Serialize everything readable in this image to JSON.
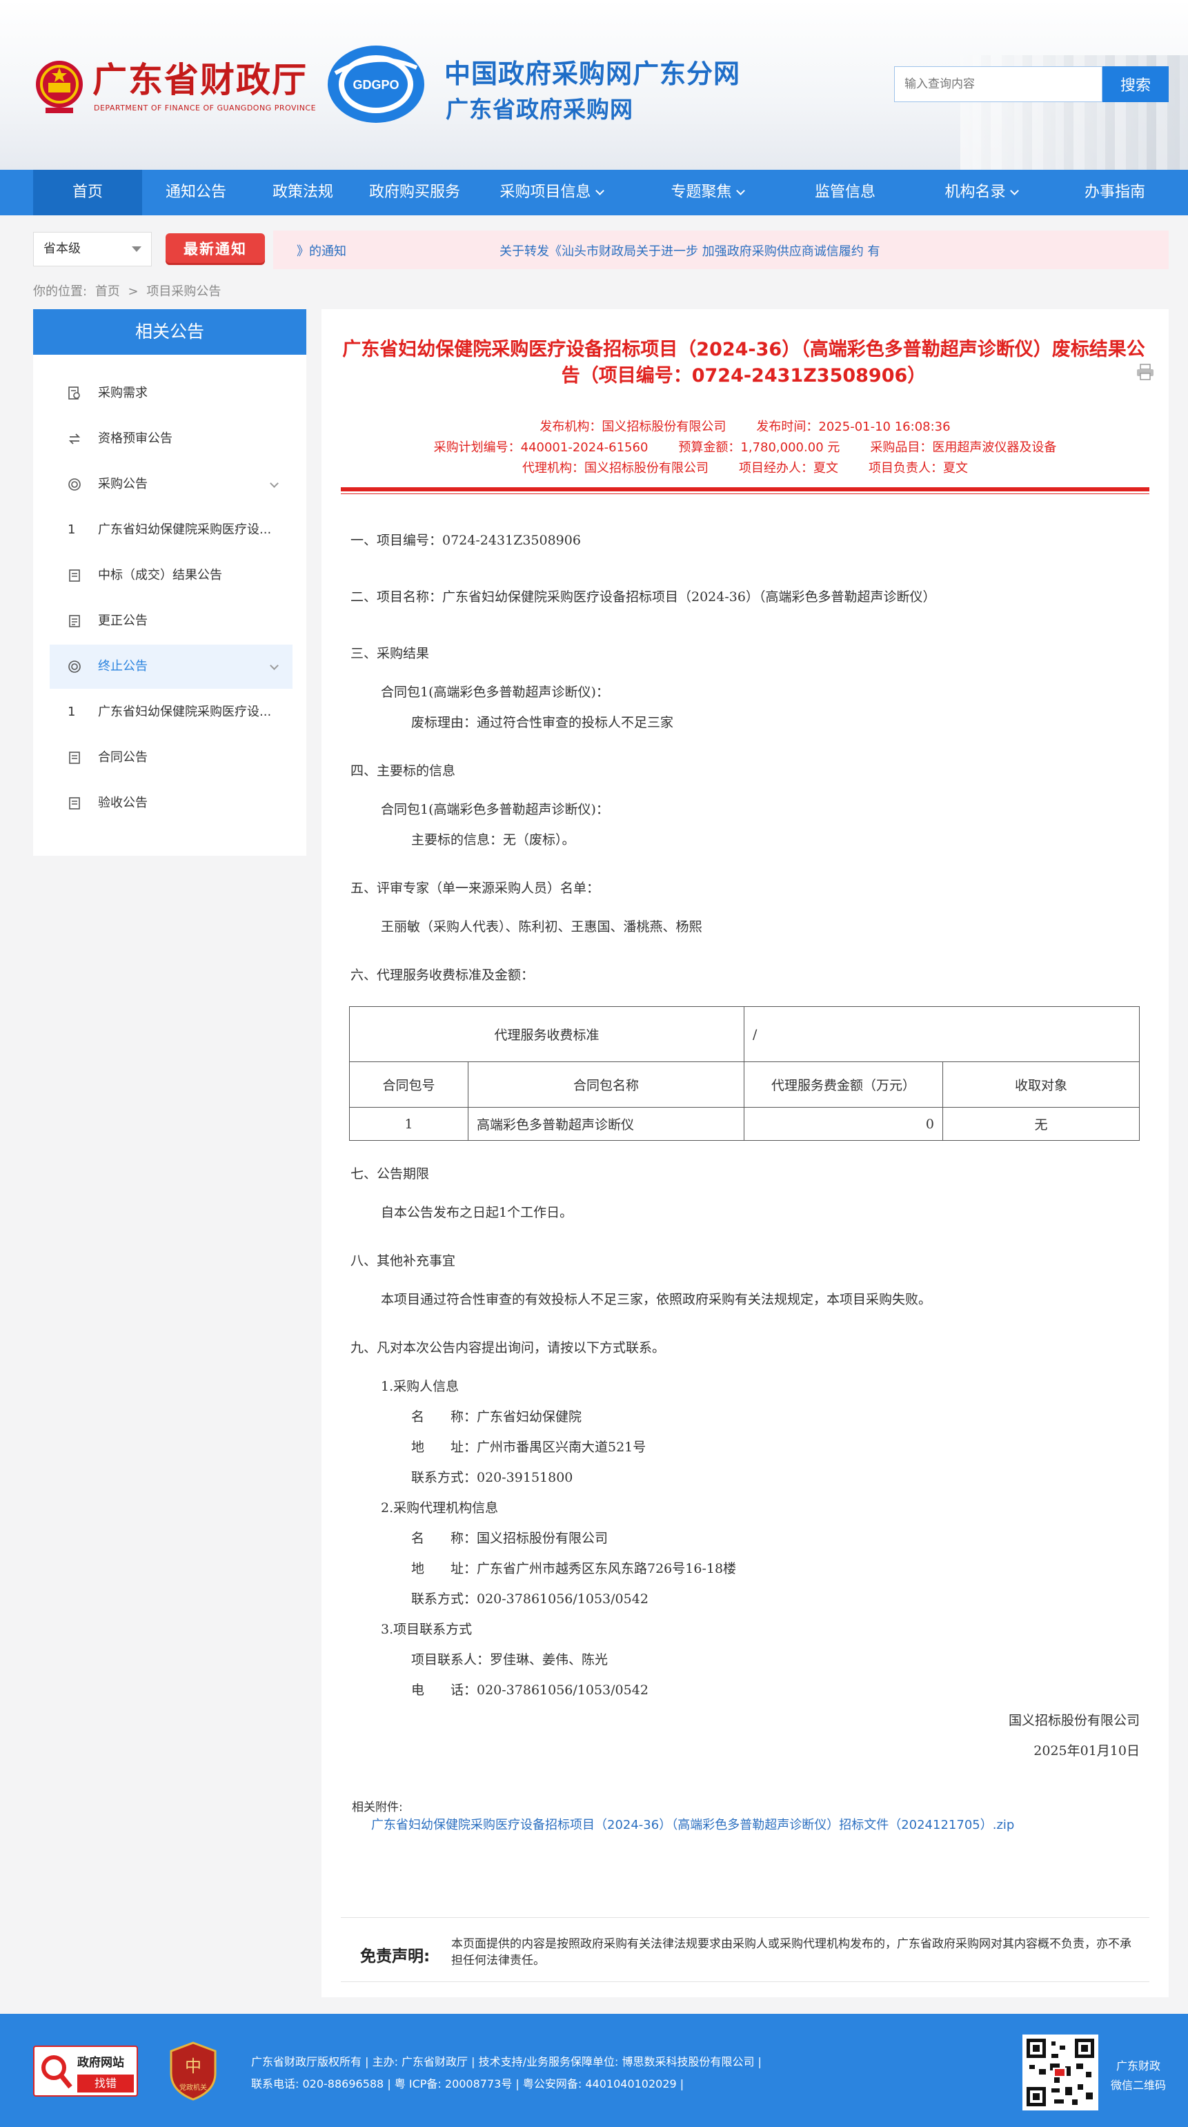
{
  "header": {
    "fin_title": "广东省财政厅",
    "fin_sub": "DEPARTMENT OF FINANCE OF GUANGDONG PROVINCE",
    "gdgpo_logo_text": "GDGPO",
    "cgp_title": "中国政府采购网广东分网",
    "cgp_sub": "广东省政府采购网",
    "search_placeholder": "输入查询内容",
    "search_button": "搜索"
  },
  "nav": [
    {
      "label": "首页",
      "active": true
    },
    {
      "label": "通知公告"
    },
    {
      "label": "政策法规"
    },
    {
      "label": "政府购买服务"
    },
    {
      "label": "采购项目信息",
      "caret": true
    },
    {
      "label": "专题聚焦",
      "caret": true
    },
    {
      "label": "监管信息"
    },
    {
      "label": "机构名录",
      "caret": true
    },
    {
      "label": "办事指南"
    }
  ],
  "notice": {
    "level": "省本级",
    "badge": "最新通知",
    "item1": "》的通知",
    "item2": "关于转发《汕头市财政局关于进一步 加强政府采购供应商诚信履约 有"
  },
  "breadcrumb": {
    "prefix": "你的位置:",
    "home": "首页",
    "sep": ">",
    "current": "项目采购公告"
  },
  "sidebar": {
    "title": "相关公告",
    "items": [
      {
        "label": "采购需求",
        "icon": "doc-search-icon"
      },
      {
        "label": "资格预审公告",
        "icon": "exchange-icon"
      },
      {
        "label": "采购公告",
        "icon": "target-icon",
        "chevron": true
      },
      {
        "label": "广东省妇幼保健院采购医疗设...",
        "num": "1"
      },
      {
        "label": "中标（成交）结果公告",
        "icon": "print-doc-icon"
      },
      {
        "label": "更正公告",
        "icon": "doc-icon"
      },
      {
        "label": "终止公告",
        "icon": "target-icon",
        "chevron": true,
        "active": true
      },
      {
        "label": "广东省妇幼保健院采购医疗设...",
        "num": "1"
      },
      {
        "label": "合同公告",
        "icon": "doc-icon"
      },
      {
        "label": "验收公告",
        "icon": "doc-icon"
      }
    ]
  },
  "article": {
    "title_line1": "广东省妇幼保健院采购医疗设备招标项目（2024-36）（高端彩色多普勒超声诊断仪）废标结果公",
    "title_line2": "告（项目编号：0724-2431Z3508906）",
    "meta1": [
      "发布机构：国义招标股份有限公司",
      "发布时间：2025-01-10 16:08:36"
    ],
    "meta2": [
      "采购计划编号：440001-2024-61560",
      "预算金额：1,780,000.00 元",
      "采购品目：医用超声波仪器及设备"
    ],
    "meta3": [
      "代理机构：国义招标股份有限公司",
      "项目经办人：夏文",
      "项目负责人：夏文"
    ],
    "s1": "一、项目编号：0724-2431Z3508906",
    "s2": "二、项目名称：广东省妇幼保健院采购医疗设备招标项目（2024-36）（高端彩色多普勒超声诊断仪）",
    "s3": "三、采购结果",
    "s3_pkg": "合同包1(高端彩色多普勒超声诊断仪)：",
    "s3_reason": "废标理由：通过符合性审查的投标人不足三家",
    "s4": "四、主要标的信息",
    "s4_pkg": "合同包1(高端彩色多普勒超声诊断仪)：",
    "s4_info": "主要标的信息：无（废标）。",
    "s5": "五、评审专家（单一来源采购人员）名单：",
    "s5_names": "王丽敏（采购人代表）、陈利初、王惠国、潘桃燕、杨熙",
    "s6": "六、代理服务收费标准及金额：",
    "table": {
      "std_label": "代理服务收费标准",
      "std_value": "/",
      "headers": [
        "合同包号",
        "合同包名称",
        "代理服务费金额（万元）",
        "收取对象"
      ],
      "rows": [
        [
          "1",
          "高端彩色多普勒超声诊断仪",
          "0",
          "无"
        ]
      ]
    },
    "s7": "七、公告期限",
    "s7_text": "自本公告发布之日起1个工作日。",
    "s8": "八、其他补充事宜",
    "s8_text": "本项目通过符合性审查的有效投标人不足三家，依照政府采购有关法规规定，本项目采购失败。",
    "s9": "九、凡对本次公告内容提出询问，请按以下方式联系。",
    "c1": "1.采购人信息",
    "c1_name": "名　　称：广东省妇幼保健院",
    "c1_addr": "地　　址：广州市番禺区兴南大道521号",
    "c1_tel": "联系方式：020-39151800",
    "c2": "2.采购代理机构信息",
    "c2_name": "名　　称：国义招标股份有限公司",
    "c2_addr": "地　　址：广东省广州市越秀区东风东路726号16-18楼",
    "c2_tel": "联系方式：020-37861056/1053/0542",
    "c3": "3.项目联系方式",
    "c3_person": "项目联系人：罗佳琳、姜伟、陈光",
    "c3_tel": "电　　话：020-37861056/1053/0542",
    "sign_org": "国义招标股份有限公司",
    "sign_date": "2025年01月10日",
    "attach_label": "相关附件:",
    "attach_link": "广东省妇幼保健院采购医疗设备招标项目（2024-36）（高端彩色多普勒超声诊断仪）招标文件（2024121705）.zip",
    "disc_label": "免责声明:",
    "disc_text": "本页面提供的内容是按照政府采购有关法律法规要求由采购人或采购代理机构发布的，广东省政府采购网对其内容概不负责，亦不承担任何法律责任。"
  },
  "footer": {
    "badge1_t1": "政府网站",
    "badge1_t2": "找错",
    "badge2": "党政机关",
    "line1": "广东省财政厅版权所有 | 主办: 广东省财政厅 | 技术支持/业务服务保障单位: 博思数采科技股份有限公司 |",
    "line2": "联系电话: 020-88696588 | 粤 ICP备: 20008773号 | 粤公安网备: 4401040102029 |",
    "qr_label_1": "广东财政",
    "qr_label_2": "微信二维码"
  },
  "colors": {
    "brand_blue": "#2b84df",
    "title_red": "#e0221f",
    "fin_red": "#c41a1a"
  }
}
